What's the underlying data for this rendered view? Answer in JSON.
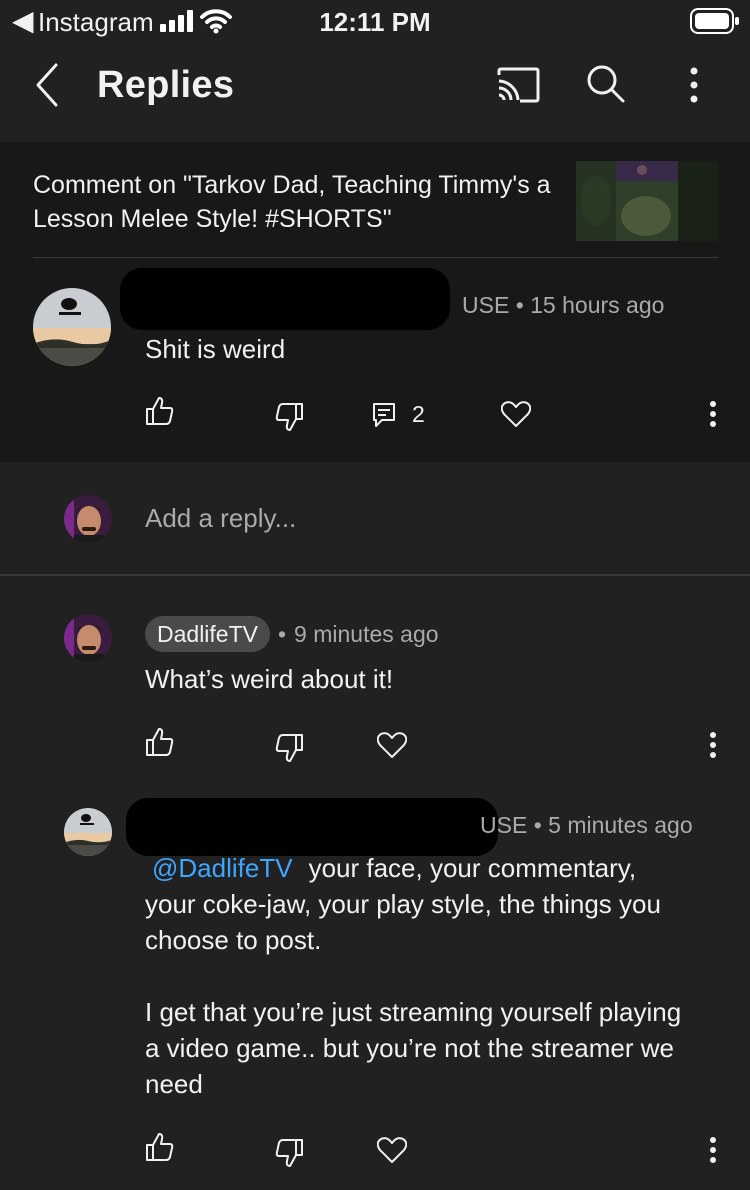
{
  "status_bar": {
    "back_arrow": "◀",
    "app": "Instagram",
    "time": "12:11 PM",
    "icons": [
      "cellular-signal-icon",
      "wifi-icon",
      "battery-icon"
    ]
  },
  "header": {
    "title": "Replies",
    "icons": [
      "back-chevron-icon",
      "cast-icon",
      "search-icon",
      "more-vert-icon"
    ]
  },
  "context": {
    "text": "Comment on \"Tarkov Dad, Teaching Timmy's a Lesson Melee Style! #SHORTS\""
  },
  "parent_comment": {
    "author_visible_suffix": "USE",
    "time": "15 hours ago",
    "text": "Shit is weird",
    "reply_count": "2"
  },
  "reply_box": {
    "placeholder": "Add a reply..."
  },
  "replies": [
    {
      "author": "DadlifeTV",
      "time": "9 minutes ago",
      "text": "What’s weird about it!"
    },
    {
      "author_visible_suffix": "USE",
      "time": "5 minutes ago",
      "mention": "@DadlifeTV",
      "text_line1": "your face, your commentary,",
      "text_rest": "your coke-jaw, your play style, the things you choose to post.",
      "text_p2": "I get that you’re just streaming yourself playing a video game.. but you’re not the streamer we need"
    }
  ],
  "colors": {
    "background": "#212121",
    "context_background": "#181818",
    "text": "#f1f1f1",
    "secondary_text": "#aaaaaa",
    "mention": "#3ea6ff"
  }
}
